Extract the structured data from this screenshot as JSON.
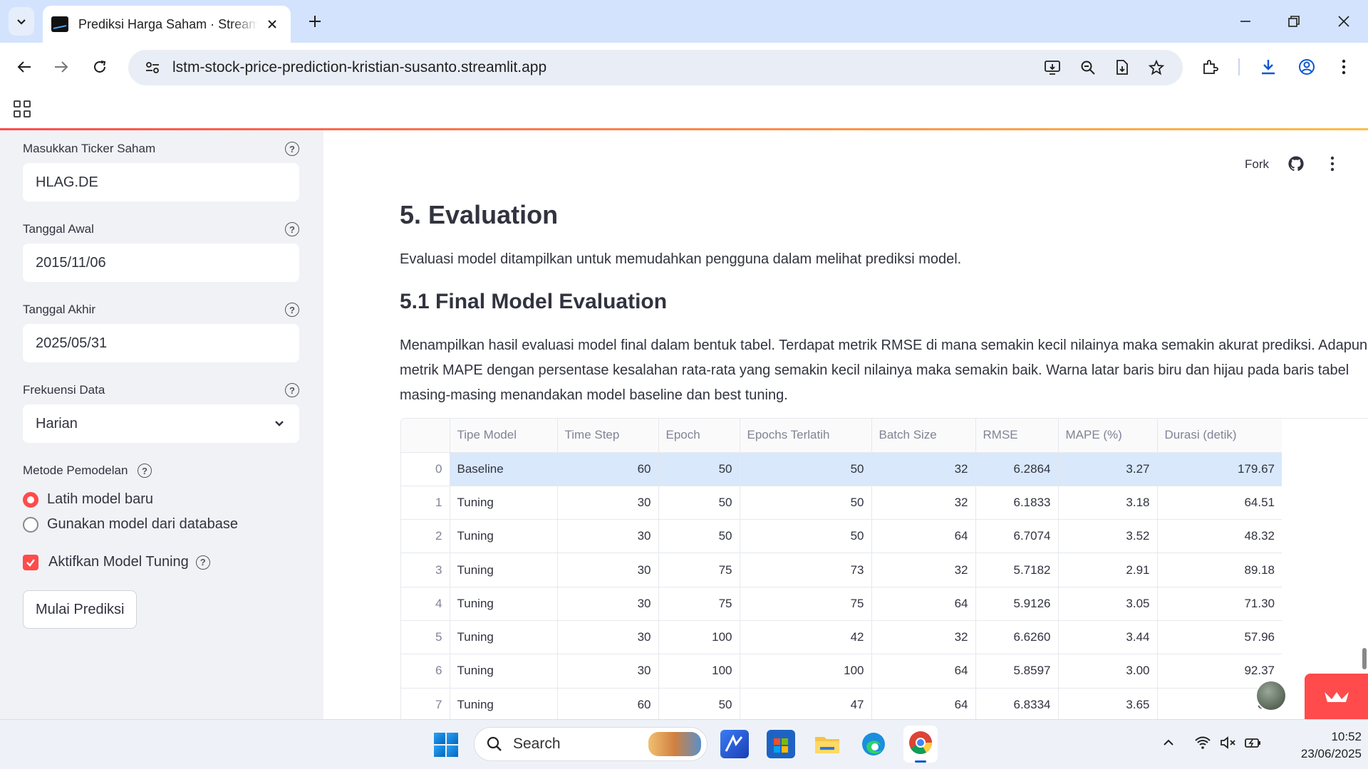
{
  "browser": {
    "tab_title": "Prediksi Harga Saham · Streamlit",
    "url": "lstm-stock-price-prediction-kristian-susanto.streamlit.app"
  },
  "sidebar": {
    "ticker": {
      "label": "Masukkan Ticker Saham",
      "value": "HLAG.DE"
    },
    "start_date": {
      "label": "Tanggal Awal",
      "value": "2015/11/06"
    },
    "end_date": {
      "label": "Tanggal Akhir",
      "value": "2025/05/31"
    },
    "frequency": {
      "label": "Frekuensi Data",
      "value": "Harian"
    },
    "method": {
      "label": "Metode Pemodelan",
      "options": [
        "Latih model baru",
        "Gunakan model dari database"
      ],
      "selected": 0
    },
    "tuning_checkbox": {
      "label": "Aktifkan Model Tuning",
      "checked": true
    },
    "start_button": "Mulai Prediksi"
  },
  "header": {
    "fork": "Fork"
  },
  "content": {
    "section_title": "5. Evaluation",
    "section_text": "Evaluasi model ditampilkan untuk memudahkan pengguna dalam melihat prediksi model.",
    "subsection_title": "5.1 Final Model Evaluation",
    "subsection_text": "Menampilkan hasil evaluasi model final dalam bentuk tabel. Terdapat metrik RMSE di mana semakin kecil nilainya maka semakin akurat prediksi. Adapun metrik MAPE dengan persentase kesalahan rata-rata yang semakin kecil nilainya maka semakin baik. Warna latar baris biru dan hijau pada baris tabel masing-masing menandakan model baseline dan best tuning."
  },
  "table": {
    "columns": [
      "",
      "Tipe Model",
      "Time Step",
      "Epoch",
      "Epochs Terlatih",
      "Batch Size",
      "RMSE",
      "MAPE (%)",
      "Durasi (detik)"
    ],
    "rows": [
      [
        "0",
        "Baseline",
        "60",
        "50",
        "50",
        "32",
        "6.2864",
        "3.27",
        "179.67"
      ],
      [
        "1",
        "Tuning",
        "30",
        "50",
        "50",
        "32",
        "6.1833",
        "3.18",
        "64.51"
      ],
      [
        "2",
        "Tuning",
        "30",
        "50",
        "50",
        "64",
        "6.7074",
        "3.52",
        "48.32"
      ],
      [
        "3",
        "Tuning",
        "30",
        "75",
        "73",
        "32",
        "5.7182",
        "2.91",
        "89.18"
      ],
      [
        "4",
        "Tuning",
        "30",
        "75",
        "75",
        "64",
        "5.9126",
        "3.05",
        "71.30"
      ],
      [
        "5",
        "Tuning",
        "30",
        "100",
        "42",
        "32",
        "6.6260",
        "3.44",
        "57.96"
      ],
      [
        "6",
        "Tuning",
        "30",
        "100",
        "100",
        "64",
        "5.8597",
        "3.00",
        "92.37"
      ],
      [
        "7",
        "Tuning",
        "60",
        "50",
        "47",
        "64",
        "6.8334",
        "3.65",
        "81."
      ]
    ]
  },
  "taskbar": {
    "search_label": "Search",
    "time": "10:52",
    "date": "23/06/2025"
  },
  "colors": {
    "accent": "#ff4b4b",
    "baseline_row": "#d9e8fb",
    "sidebar_bg": "#f0f2f6"
  }
}
